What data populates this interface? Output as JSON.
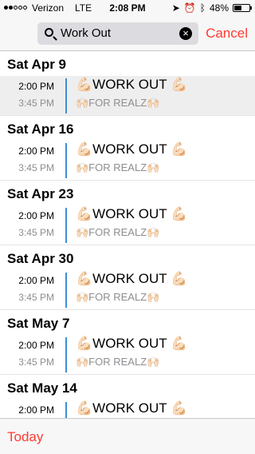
{
  "status": {
    "carrier": "Verizon",
    "network": "LTE",
    "time": "2:08 PM",
    "battery": "48%",
    "battery_level": 0.48,
    "signal_bars": 2,
    "icons": [
      "location-arrow-icon",
      "alarm-clock-icon",
      "bluetooth-icon",
      "battery-icon"
    ]
  },
  "search": {
    "query": "Work Out",
    "cancel": "Cancel"
  },
  "sections": [
    {
      "date": "Sat  Apr 9",
      "events": [
        {
          "start": "2:00 PM",
          "end": "3:45 PM",
          "title": "💪🏻WORK OUT 💪🏻",
          "note": "🙌🏻FOR REALZ🙌🏻",
          "selected": true
        }
      ]
    },
    {
      "date": "Sat  Apr 16",
      "events": [
        {
          "start": "2:00 PM",
          "end": "3:45 PM",
          "title": "💪🏻WORK OUT 💪🏻",
          "note": "🙌🏻FOR REALZ🙌🏻",
          "selected": false
        }
      ]
    },
    {
      "date": "Sat  Apr 23",
      "events": [
        {
          "start": "2:00 PM",
          "end": "3:45 PM",
          "title": "💪🏻WORK OUT 💪🏻",
          "note": "🙌🏻FOR REALZ🙌🏻",
          "selected": false
        }
      ]
    },
    {
      "date": "Sat  Apr 30",
      "events": [
        {
          "start": "2:00 PM",
          "end": "3:45 PM",
          "title": "💪🏻WORK OUT 💪🏻",
          "note": "🙌🏻FOR REALZ🙌🏻",
          "selected": false
        }
      ]
    },
    {
      "date": "Sat  May 7",
      "events": [
        {
          "start": "2:00 PM",
          "end": "3:45 PM",
          "title": "💪🏻WORK OUT 💪🏻",
          "note": "🙌🏻FOR REALZ🙌🏻",
          "selected": false
        }
      ]
    },
    {
      "date": "Sat  May 14",
      "events": [
        {
          "start": "2:00 PM",
          "end": "",
          "title": "💪🏻WORK OUT 💪🏻",
          "note": "",
          "selected": false
        }
      ]
    }
  ],
  "toolbar": {
    "today": "Today"
  },
  "colors": {
    "accent": "#ff3b30",
    "event_bar": "#3a8fd8"
  }
}
